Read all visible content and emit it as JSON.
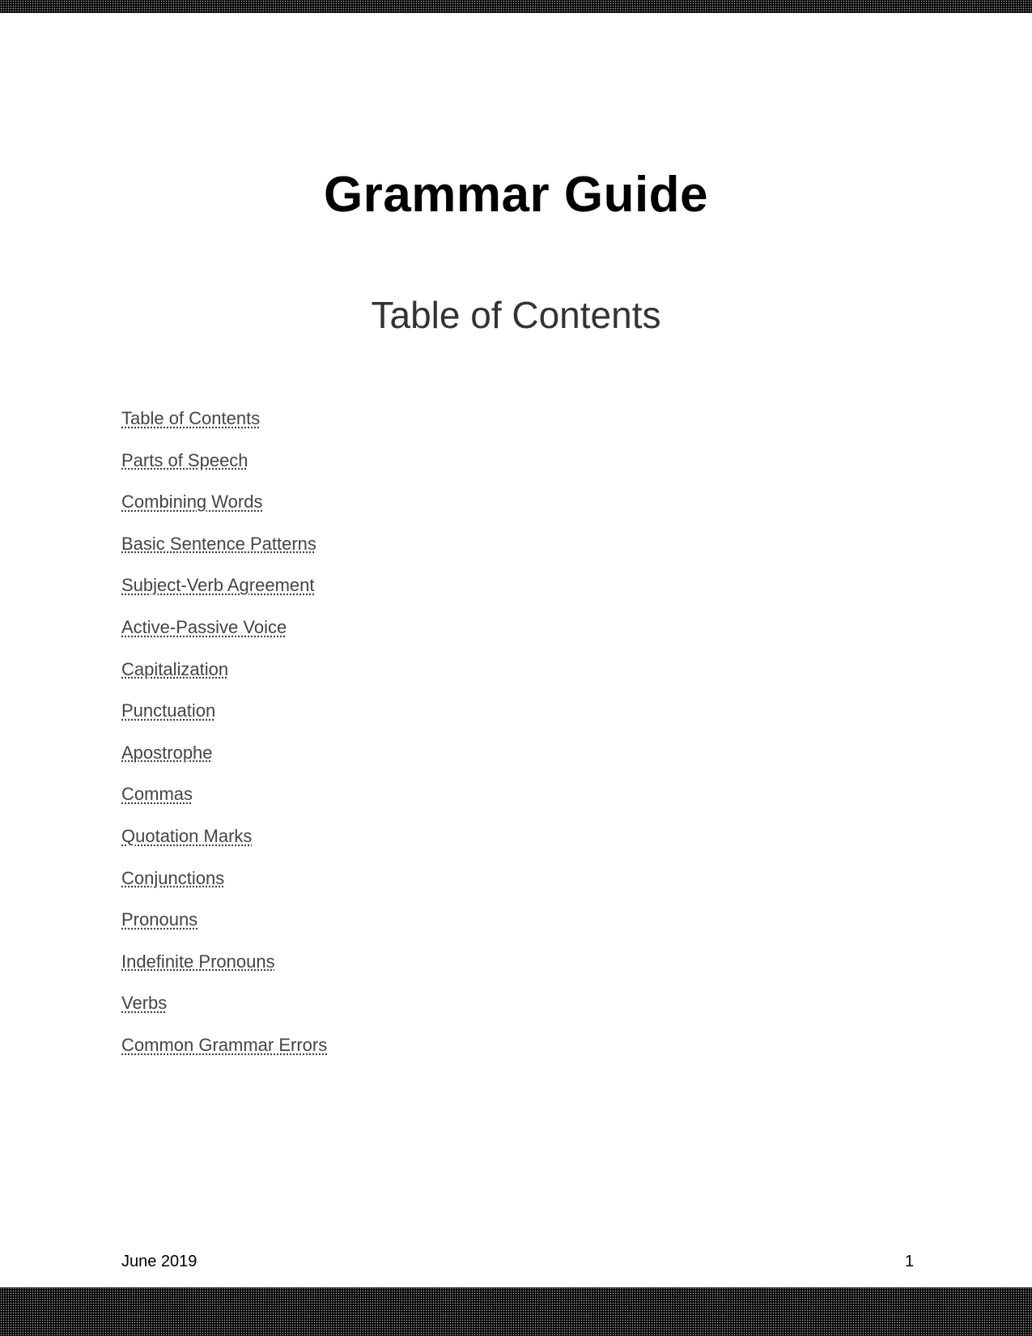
{
  "document": {
    "title": "Grammar Guide",
    "subtitle": "Table of Contents"
  },
  "toc": {
    "items": [
      {
        "label": "Table of Contents"
      },
      {
        "label": "Parts of Speech"
      },
      {
        "label": "Combining Words"
      },
      {
        "label": "Basic Sentence Patterns"
      },
      {
        "label": "Subject-Verb Agreement"
      },
      {
        "label": "Active-Passive Voice"
      },
      {
        "label": "Capitalization"
      },
      {
        "label": "Punctuation"
      },
      {
        "label": "Apostrophe"
      },
      {
        "label": "Commas"
      },
      {
        "label": "Quotation Marks"
      },
      {
        "label": "Conjunctions"
      },
      {
        "label": "Pronouns"
      },
      {
        "label": "Indefinite Pronouns"
      },
      {
        "label": "Verbs"
      },
      {
        "label": "Common Grammar Errors"
      }
    ]
  },
  "footer": {
    "date": "June 2019",
    "page_number": "1"
  }
}
